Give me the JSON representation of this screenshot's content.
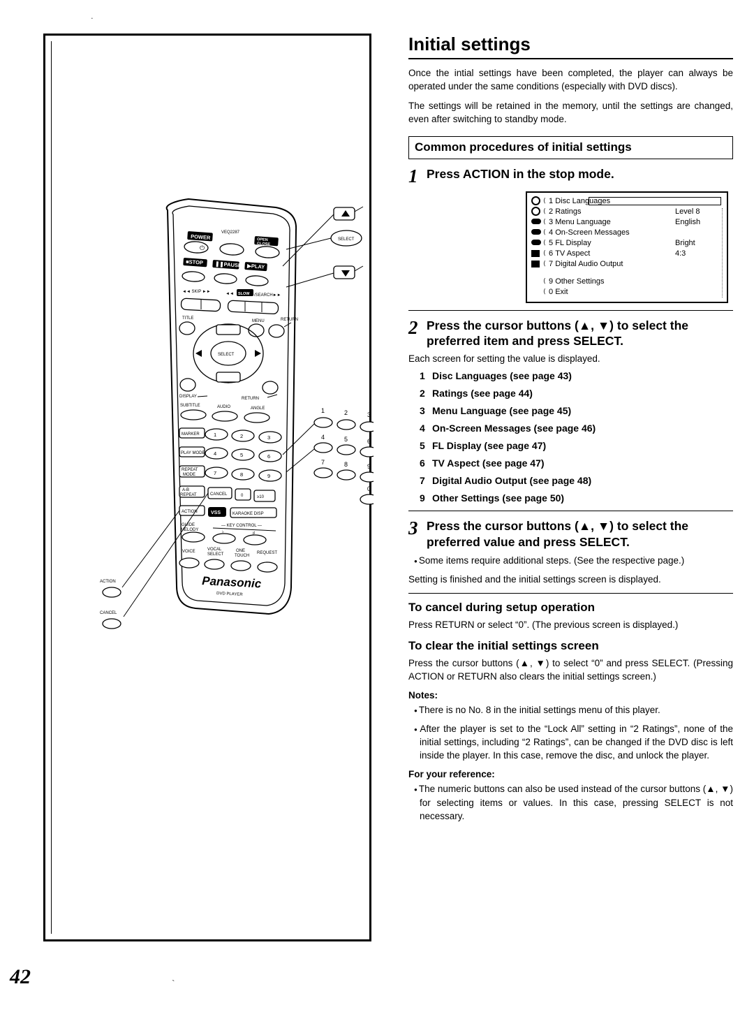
{
  "page": {
    "number": "42",
    "title": "Initial settings"
  },
  "intro": {
    "para1": "Once the intial settings have been completed, the player can always be operated under the same conditions (especially with DVD discs).",
    "para2": "The settings will be retained in the memory, until the settings are changed, even after switching to standby mode."
  },
  "section": {
    "heading": "Common procedures of initial settings"
  },
  "steps": [
    {
      "num": "1",
      "text": "Press ACTION in the stop mode."
    },
    {
      "num": "2",
      "text": "Press the cursor buttons (▲, ▼) to select the preferred item and press SELECT.",
      "note": "Each screen for setting the value is displayed."
    },
    {
      "num": "3",
      "text": "Press the cursor buttons (▲, ▼) to select the preferred value and press SELECT.",
      "bullet": "Some items require additional steps. (See the respective page.)",
      "after": "Setting is finished and the initial settings screen is displayed."
    }
  ],
  "item_list": [
    {
      "n": "1",
      "label": "Disc Languages (see page 43)"
    },
    {
      "n": "2",
      "label": "Ratings (see page 44)"
    },
    {
      "n": "3",
      "label": "Menu Language (see page 45)"
    },
    {
      "n": "4",
      "label": "On-Screen Messages (see page 46)"
    },
    {
      "n": "5",
      "label": "FL Display (see page 47)"
    },
    {
      "n": "6",
      "label": "TV Aspect (see page 47)"
    },
    {
      "n": "7",
      "label": "Digital Audio Output (see page 48)"
    },
    {
      "n": "9",
      "label": "Other Settings (see page 50)"
    }
  ],
  "osd": {
    "rows": [
      {
        "icon": "circle",
        "marker": "⟨",
        "num": "1",
        "label": "Disc Languages",
        "value": ""
      },
      {
        "icon": "circle",
        "marker": "⟨",
        "num": "2",
        "label": "Ratings",
        "value": "Level 8"
      },
      {
        "icon": "pill",
        "marker": "⟨",
        "num": "3",
        "label": "Menu Language",
        "value": "English"
      },
      {
        "icon": "pill",
        "marker": "⟨",
        "num": "4",
        "label": "On-Screen Messages",
        "value": ""
      },
      {
        "icon": "pill",
        "marker": "⟨",
        "num": "5",
        "label": "FL Display",
        "value": "Bright"
      },
      {
        "icon": "sq",
        "marker": "⟨",
        "num": "6",
        "label": "TV Aspect",
        "value": "4:3"
      },
      {
        "icon": "sq",
        "marker": "⟨",
        "num": "7",
        "label": "Digital Audio Output",
        "value": ""
      }
    ],
    "rows2": [
      {
        "marker": "⟨",
        "num": "9",
        "label": "Other Settings"
      },
      {
        "marker": "⟨",
        "num": "0",
        "label": "Exit"
      }
    ]
  },
  "cancel_section": {
    "heading": "To cancel during setup operation",
    "body": "Press RETURN or select “0”. (The previous screen is displayed.)"
  },
  "clear_section": {
    "heading": "To clear the initial settings screen",
    "body": "Press the cursor buttons (▲, ▼) to select “0” and press SELECT. (Pressing ACTION or RETURN also clears the initial settings screen.)"
  },
  "notes": {
    "label": "Notes:",
    "items": [
      "There is no No. 8 in the initial settings menu of this player.",
      "After the player is set to the “Lock All” setting in “2 Ratings”, none of the initial settings, including “2 Ratings”, can be changed if the DVD disc is left inside the player. In this case, remove the disc, and unlock the player."
    ]
  },
  "reference": {
    "label": "For your reference:",
    "items": [
      "The numeric buttons can also be used instead of the cursor buttons (▲, ▼) for selecting items or values. In this case, pressing SELECT is not necessary."
    ]
  },
  "remote": {
    "brand": "Panasonic",
    "sub_brand": "DVD PLAYER",
    "model_code": "VEQ2287",
    "buttons": {
      "power": "POWER",
      "open_close": "OPEN/CLOSE",
      "select_top": "SELECT",
      "stop": "STOP",
      "pause": "PAUSE",
      "play": "PLAY",
      "skip": "SKIP",
      "slow_search": "SLOW/SEARCH",
      "title": "TITLE",
      "menu": "MENU",
      "return": "RETURN",
      "select_center": "SELECT",
      "display": "DISPLAY",
      "return2": "RETURN",
      "subtitle": "SUBTITLE",
      "audio": "AUDIO",
      "angle": "ANGLE",
      "marker": "MARKER",
      "play_mode": "PLAY MODE",
      "repeat_mode": "REPEAT MODE",
      "ab_repeat": "A-B REPEAT",
      "cancel": "CANCEL",
      "action": "ACTION",
      "vss": "VSS",
      "karaoke_disp": "KARAOKE DISP",
      "guide_melody": "GUIDE MELODY",
      "key_control": "KEY CONTROL",
      "voice": "VOICE",
      "vocal_select": "VOCAL SELECT",
      "one_touch": "ONE TOUCH",
      "request": "REQUEST"
    },
    "numeric": [
      "1",
      "2",
      "3",
      "4",
      "5",
      "6",
      "7",
      "8",
      "9",
      "0",
      "≥10"
    ],
    "callouts": {
      "action": "ACTION",
      "cancel": "CANCEL"
    }
  }
}
